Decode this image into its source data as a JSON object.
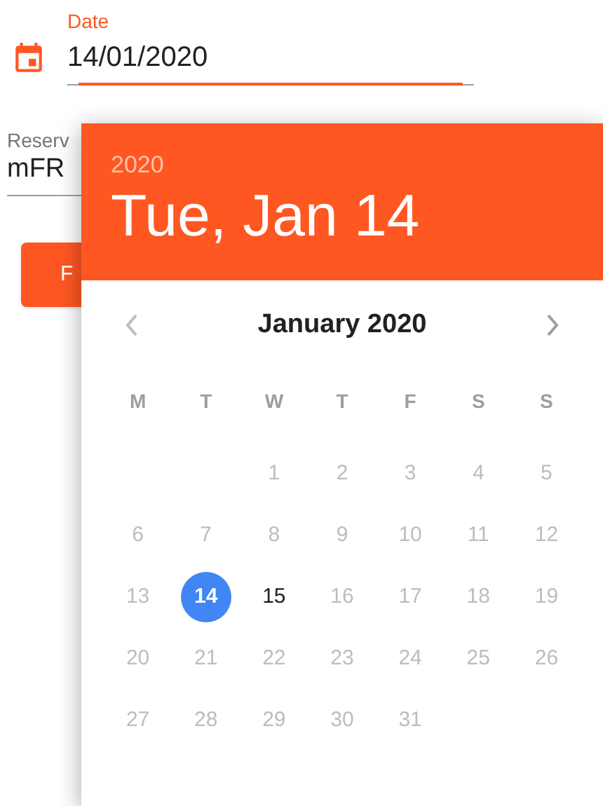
{
  "date_field": {
    "label": "Date",
    "value": "14/01/2020",
    "focused": true
  },
  "reserve_field": {
    "label": "Reserv",
    "value": "mFR"
  },
  "button": {
    "label": "F"
  },
  "picker": {
    "year": "2020",
    "date": "Tue, Jan 14",
    "month": "January 2020",
    "weekdays": [
      "M",
      "T",
      "W",
      "T",
      "F",
      "S",
      "S"
    ],
    "weeks": [
      [
        {
          "kind": "blank"
        },
        {
          "kind": "blank"
        },
        {
          "kind": "day",
          "label": "1",
          "selected": false,
          "disabled": true
        },
        {
          "kind": "day",
          "label": "2",
          "selected": false,
          "disabled": true
        },
        {
          "kind": "day",
          "label": "3",
          "selected": false,
          "disabled": true
        },
        {
          "kind": "day",
          "label": "4",
          "selected": false,
          "disabled": true
        },
        {
          "kind": "day",
          "label": "5",
          "selected": false,
          "disabled": true
        }
      ],
      [
        {
          "kind": "day",
          "label": "6",
          "selected": false,
          "disabled": true
        },
        {
          "kind": "day",
          "label": "7",
          "selected": false,
          "disabled": true
        },
        {
          "kind": "day",
          "label": "8",
          "selected": false,
          "disabled": true
        },
        {
          "kind": "day",
          "label": "9",
          "selected": false,
          "disabled": true
        },
        {
          "kind": "day",
          "label": "10",
          "selected": false,
          "disabled": true
        },
        {
          "kind": "day",
          "label": "11",
          "selected": false,
          "disabled": true
        },
        {
          "kind": "day",
          "label": "12",
          "selected": false,
          "disabled": true
        }
      ],
      [
        {
          "kind": "day",
          "label": "13",
          "selected": false,
          "disabled": true
        },
        {
          "kind": "day",
          "label": "14",
          "selected": true,
          "disabled": false
        },
        {
          "kind": "day",
          "label": "15",
          "selected": false,
          "disabled": false
        },
        {
          "kind": "day",
          "label": "16",
          "selected": false,
          "disabled": true
        },
        {
          "kind": "day",
          "label": "17",
          "selected": false,
          "disabled": true
        },
        {
          "kind": "day",
          "label": "18",
          "selected": false,
          "disabled": true
        },
        {
          "kind": "day",
          "label": "19",
          "selected": false,
          "disabled": true
        }
      ],
      [
        {
          "kind": "day",
          "label": "20",
          "selected": false,
          "disabled": true
        },
        {
          "kind": "day",
          "label": "21",
          "selected": false,
          "disabled": true
        },
        {
          "kind": "day",
          "label": "22",
          "selected": false,
          "disabled": true
        },
        {
          "kind": "day",
          "label": "23",
          "selected": false,
          "disabled": true
        },
        {
          "kind": "day",
          "label": "24",
          "selected": false,
          "disabled": true
        },
        {
          "kind": "day",
          "label": "25",
          "selected": false,
          "disabled": true
        },
        {
          "kind": "day",
          "label": "26",
          "selected": false,
          "disabled": true
        }
      ],
      [
        {
          "kind": "day",
          "label": "27",
          "selected": false,
          "disabled": true
        },
        {
          "kind": "day",
          "label": "28",
          "selected": false,
          "disabled": true
        },
        {
          "kind": "day",
          "label": "29",
          "selected": false,
          "disabled": true
        },
        {
          "kind": "day",
          "label": "30",
          "selected": false,
          "disabled": true
        },
        {
          "kind": "day",
          "label": "31",
          "selected": false,
          "disabled": true
        },
        {
          "kind": "blank"
        },
        {
          "kind": "blank"
        }
      ]
    ]
  }
}
